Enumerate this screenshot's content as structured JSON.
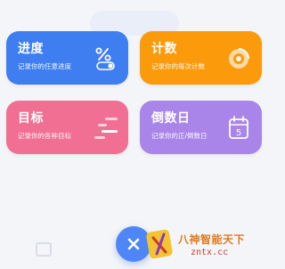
{
  "cards": [
    {
      "title": "进度",
      "subtitle": "记录你的任意进度",
      "icon": "percent-toggle-icon",
      "color": "#3f7ef0"
    },
    {
      "title": "计数",
      "subtitle": "记录你的每次计数",
      "icon": "counter-dial-icon",
      "color": "#fb9a0a"
    },
    {
      "title": "目标",
      "subtitle": "记录你的各种目标",
      "icon": "target-bars-icon",
      "color": "#f06f92"
    },
    {
      "title": "倒数日",
      "subtitle": "记录你的正/倒数日",
      "icon": "calendar-icon",
      "color": "#a985ea"
    }
  ],
  "calendar_day": "5",
  "fab_icon": "close-icon",
  "watermark": {
    "name": "八神智能天下",
    "url": "zntx.cc"
  }
}
